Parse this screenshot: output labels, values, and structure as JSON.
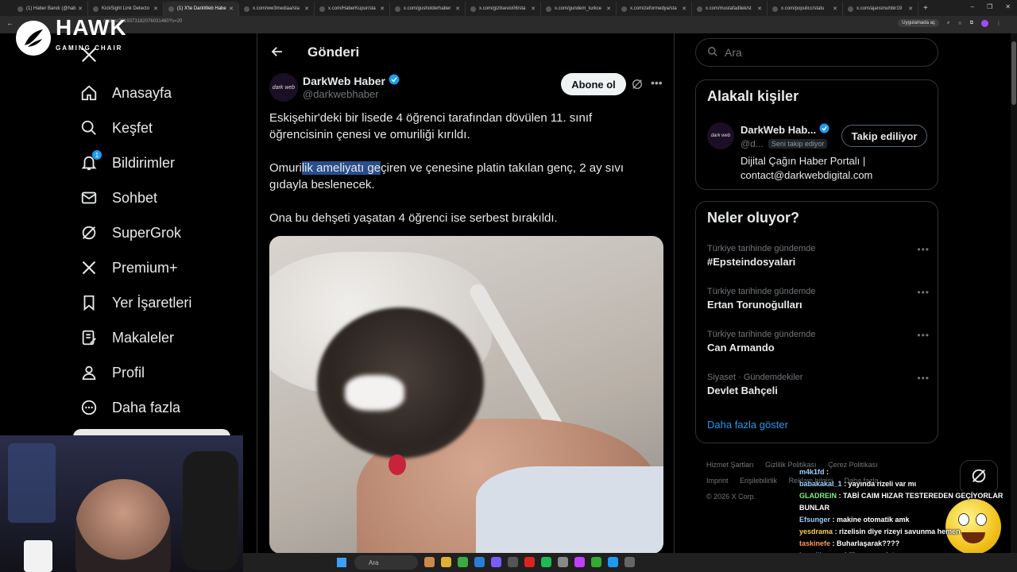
{
  "browser": {
    "tabs": [
      {
        "label": "(1) Haber Bandı (@hab",
        "active": false
      },
      {
        "label": "KickSight Link Detecto",
        "active": false
      },
      {
        "label": "(1) X'te DarkWeb Habe",
        "active": true
      },
      {
        "label": "x.com/ww3mediaa/sta",
        "active": false
      },
      {
        "label": "x.com/HaberKupur/sta",
        "active": false
      },
      {
        "label": "x.com/gusholderhaber",
        "active": false
      },
      {
        "label": "x.com/gizlisevio06/sta",
        "active": false
      },
      {
        "label": "x.com/gundem_turkce",
        "active": false
      },
      {
        "label": "x.com/zeformedya/sta",
        "active": false
      },
      {
        "label": "x.com/mustafadilek/st",
        "active": false
      },
      {
        "label": "x.com/populicc/statu",
        "active": false
      },
      {
        "label": "x.com/ajansmuhbir19",
        "active": false
      }
    ],
    "url": "/status/2019373182076031460?s=20",
    "app_badge": "Uygulamada aç"
  },
  "overlay_logo": {
    "title": "HAWK",
    "subtitle": "GAMING CHAIR"
  },
  "nav": {
    "items": [
      {
        "label": "Anasayfa",
        "icon": "home-icon"
      },
      {
        "label": "Keşfet",
        "icon": "search-icon"
      },
      {
        "label": "Bildirimler",
        "icon": "bell-icon",
        "badge": "1"
      },
      {
        "label": "Sohbet",
        "icon": "mail-icon"
      },
      {
        "label": "SuperGrok",
        "icon": "grok-icon"
      },
      {
        "label": "Premium+",
        "icon": "x-logo-icon"
      },
      {
        "label": "Yer İşaretleri",
        "icon": "bookmark-icon"
      },
      {
        "label": "Makaleler",
        "icon": "article-icon"
      },
      {
        "label": "Profil",
        "icon": "user-icon"
      },
      {
        "label": "Daha fazla",
        "icon": "more-circle-icon"
      }
    ]
  },
  "main": {
    "title": "Gönderi",
    "post": {
      "author": "DarkWeb Haber",
      "handle": "@darkwebhaber",
      "avatar_text": "dark web",
      "follow_label": "Abone ol",
      "para1": "Eskişehir'deki bir lisede 4 öğrenci tarafından dövülen 11. sınıf öğrencisinin çenesi ve omuriliği kırıldı.",
      "para2_pre": "Omuri",
      "para2_hl": "lik ameliyatı ge",
      "para2_post": "çiren ve çenesine platin takılan genç, 2 ay sıvı gıdayla beslenecek.",
      "para3": "Ona bu dehşeti yaşatan 4 öğrenci ise serbest bırakıldı."
    }
  },
  "right": {
    "search_placeholder": "Ara",
    "related": {
      "title": "Alakalı kişiler",
      "name": "DarkWeb Hab...",
      "handle": "@d...",
      "follows_you": "Seni takip ediyor",
      "button": "Takip ediliyor",
      "bio1": "Dijital Çağın Haber Portalı |",
      "bio2": "contact@darkwebdigital.com",
      "avatar_text": "dark web"
    },
    "trends": {
      "title": "Neler oluyor?",
      "items": [
        {
          "context": "Türkiye tarihinde gündemde",
          "name": "#Epsteindosyalari"
        },
        {
          "context": "Türkiye tarihinde gündemde",
          "name": "Ertan Torunoğulları"
        },
        {
          "context": "Türkiye tarihinde gündemde",
          "name": "Can Armando"
        },
        {
          "context": "Siyaset · Gündemdekiler",
          "name": "Devlet Bahçeli"
        }
      ],
      "show_more": "Daha fazla göster"
    },
    "footer": {
      "links": [
        "Hizmet Şartları",
        "Gizlilik Politikası",
        "Çerez Politikası",
        "Imprint",
        "Erişilebilirlik",
        "Reklam bilgisi",
        "Daha fazla ..."
      ],
      "copyright": "© 2026 X Corp."
    }
  },
  "chat": [
    {
      "user": "m4k1fd",
      "text": ":",
      "cls": "u1"
    },
    {
      "user": "babakakal_1",
      "text": ": yayında rizeli var mı",
      "cls": "u1"
    },
    {
      "user": "GLADREIN",
      "text": ": TABİ CAIM HIZAR TESTEREDEN GEÇİYORLAR BUNLAR",
      "cls": "u2"
    },
    {
      "user": "Efsunger",
      "text": ": makine otomatik amk",
      "cls": "u1"
    },
    {
      "user": "yesdrama",
      "text": ": rizelisin diye rizeyi savunma hemen",
      "cls": "u3"
    },
    {
      "user": "taskinefe",
      "text": ": Buharlaşarak????",
      "cls": "u4"
    },
    {
      "user": "ismaillcann",
      "text": ": biliyosan anlatsana",
      "cls": "u5"
    }
  ],
  "taskbar": {
    "search": "Ara"
  }
}
